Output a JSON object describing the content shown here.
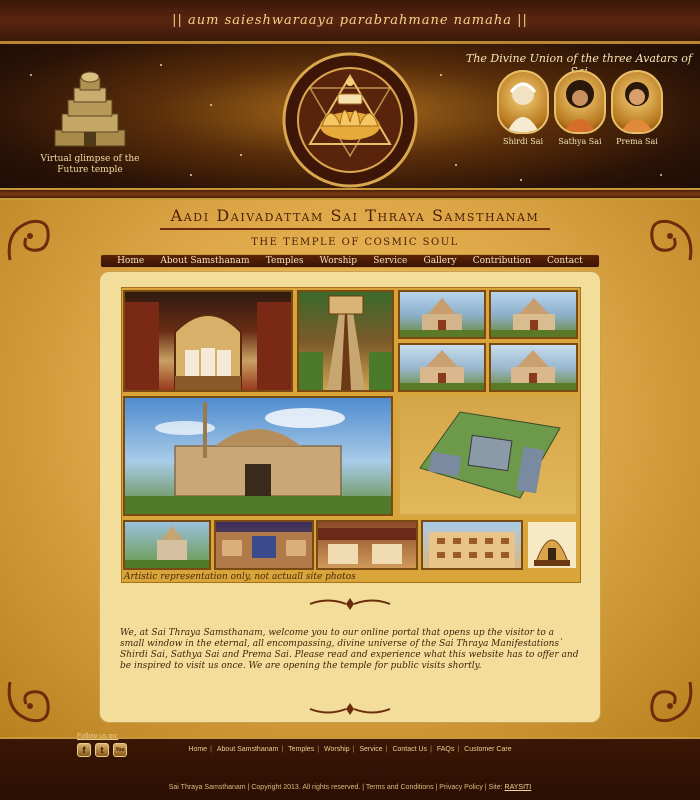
{
  "mantra": "|| aum saieshwaraaya parabrahmane namaha ||",
  "header": {
    "temple_caption": "Virtual glimpse of the Future temple",
    "avatars_title": "The Divine Union of the three Avatars of Sai",
    "avatars": [
      {
        "label": "Shirdi Sai"
      },
      {
        "label": "Sathya Sai"
      },
      {
        "label": "Prema Sai"
      }
    ]
  },
  "site": {
    "title": "Aadi Daivadattam Sai Thraya Samsthanam",
    "subtitle": "THE TEMPLE OF COSMIC SOUL"
  },
  "nav": {
    "items": [
      "Home",
      "About Samsthanam",
      "Temples",
      "Worship",
      "Service",
      "Gallery",
      "Contribution",
      "Contact"
    ]
  },
  "gallery": {
    "note": "Artistic representation only, not actuall site photos"
  },
  "welcome": {
    "text": "We, at Sai Thraya Samsthanam, welcome you to our online portal that opens up the visitor to a small window in the eternal, all encompassing, divine universe of the Sai Thraya Manifestations` Shirdi Sai, Sathya Sai and Prema Sai. Please read and experience what this website has to offer and be inspired to visit us once. We are  opening the temple for public visits shortly."
  },
  "footer": {
    "links": [
      "Home",
      "About Samsthanam",
      "Temples",
      "Worship",
      "Service",
      "Contact Us",
      "FAQs",
      "Customer Care"
    ],
    "follow_label": "Follow us on:",
    "social": [
      {
        "icon": "facebook-icon",
        "glyph": "f"
      },
      {
        "icon": "twitter-icon",
        "glyph": "t"
      },
      {
        "icon": "youtube-icon",
        "glyph": "You"
      }
    ],
    "copyright_prefix": "Sai Thraya Samsthanam | Copyright 2013. All rights reserved. | Terms and Conditions | Privacy Policy | Site:",
    "site_credit": "RAYSITI"
  },
  "colors": {
    "accent_gold": "#c8973a",
    "dark_brown": "#3a1604",
    "panel_cream": "#f2dd9a",
    "text_brown": "#4a210b"
  }
}
